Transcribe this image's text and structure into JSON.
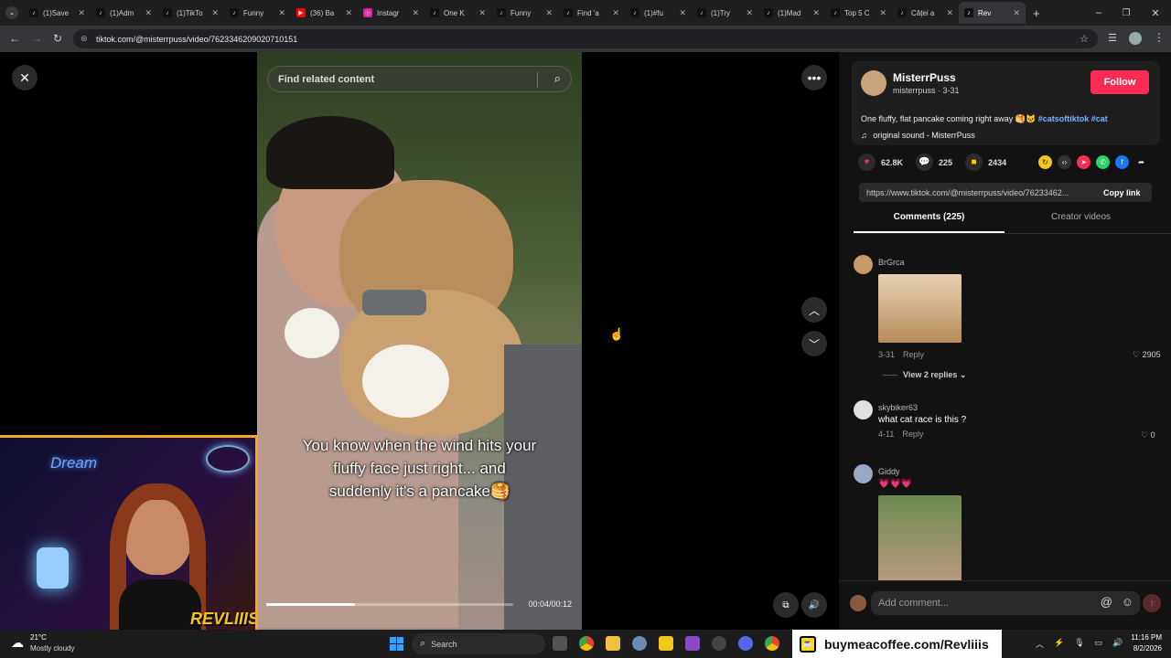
{
  "tabs": [
    {
      "title": "(1)Save",
      "icon": "tiktok-icon"
    },
    {
      "title": "(1)Adm",
      "icon": "tiktok-icon"
    },
    {
      "title": "(1)TikTo",
      "icon": "tiktok-icon"
    },
    {
      "title": "Funny",
      "icon": "tiktok-icon"
    },
    {
      "title": "(36) Ba",
      "icon": "youtube-icon"
    },
    {
      "title": "Instagr",
      "icon": "instagram-icon"
    },
    {
      "title": "One K",
      "icon": "tiktok-icon"
    },
    {
      "title": "Funny",
      "icon": "tiktok-icon"
    },
    {
      "title": "Find 'a",
      "icon": "tiktok-icon"
    },
    {
      "title": "(1)#fu",
      "icon": "tiktok-icon"
    },
    {
      "title": "(1)Try",
      "icon": "tiktok-icon"
    },
    {
      "title": "(1)Mad",
      "icon": "tiktok-icon"
    },
    {
      "title": "Top 5 C",
      "icon": "tiktok-icon"
    },
    {
      "title": "Câței a",
      "icon": "tiktok-icon"
    },
    {
      "title": "Rev",
      "icon": "tiktok-icon"
    }
  ],
  "url": "tiktok.com/@misterrpuss/video/7623346209020710151",
  "search": {
    "placeholder": "Find related content"
  },
  "video": {
    "caption_line1": "You know when the wind hits your",
    "caption_line2": "fluffy face just right... and",
    "caption_line3": "suddenly it's a pancake🥞",
    "time": "00:04/00:12",
    "progress": 0.36
  },
  "author": {
    "display_name": "MisterrPuss",
    "handle": "misterrpuss · 3-31",
    "follow_label": "Follow"
  },
  "description": {
    "text": "One fluffy, flat pancake coming right away 🥞🐱",
    "hashtags": "#catsoftiktok #cat",
    "sound": "original sound - MisterrPuss"
  },
  "stats": {
    "likes": "62.8K",
    "comments": "225",
    "saves": "2434"
  },
  "link": {
    "url": "https://www.tiktok.com/@misterrpuss/video/76233462...",
    "copy_label": "Copy link"
  },
  "panel_tabs": {
    "comments": "Comments (225)",
    "creator": "Creator videos"
  },
  "comments": [
    {
      "user": "BrGrca",
      "date": "3-31",
      "reply": "Reply",
      "likes": "2905",
      "view_replies": "View 2 replies"
    },
    {
      "user": "skybiker63",
      "text": "what cat race is this ?",
      "date": "4-11",
      "reply": "Reply",
      "likes": "0"
    },
    {
      "user": "Giddy",
      "text": "💗💗💗"
    }
  ],
  "add_comment": {
    "placeholder": "Add comment..."
  },
  "webcam": {
    "sign": "Dream",
    "brand": "REVLIIIS"
  },
  "taskbar": {
    "weather_temp": "21°C",
    "weather_desc": "Mostly cloudy",
    "search": "Search",
    "coffee_url": "buymeacoffee.com/Revliiis",
    "time": "11:16 PM",
    "date": "8/2/2026"
  },
  "colors": {
    "follow": "#fe2c55",
    "active_tab_underline": "#ffffff",
    "hashtag": "#7fb2ff"
  }
}
